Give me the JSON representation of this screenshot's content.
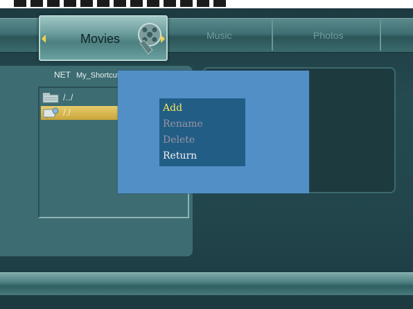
{
  "tabs": {
    "movies": "Movies",
    "music": "Music",
    "photos": "Photos"
  },
  "browser": {
    "breadcrumb": [
      "NET",
      "My_Shortcuts"
    ],
    "items": [
      {
        "icon": "folder-up-icon",
        "label": "/../"
      },
      {
        "icon": "network-folder-icon",
        "label": "/./",
        "selected": true
      }
    ]
  },
  "popup_menu": {
    "items": [
      {
        "label": "Add",
        "state": "highlighted"
      },
      {
        "label": "Rename",
        "state": "disabled"
      },
      {
        "label": "Delete",
        "state": "disabled"
      },
      {
        "label": "Return",
        "state": "enabled"
      }
    ]
  },
  "colors": {
    "highlight": "#f4e85a",
    "disabled": "#9a93a0",
    "selection": "#caa53a",
    "popup_bg": "#528fc7",
    "menu_bg": "#225d86"
  }
}
